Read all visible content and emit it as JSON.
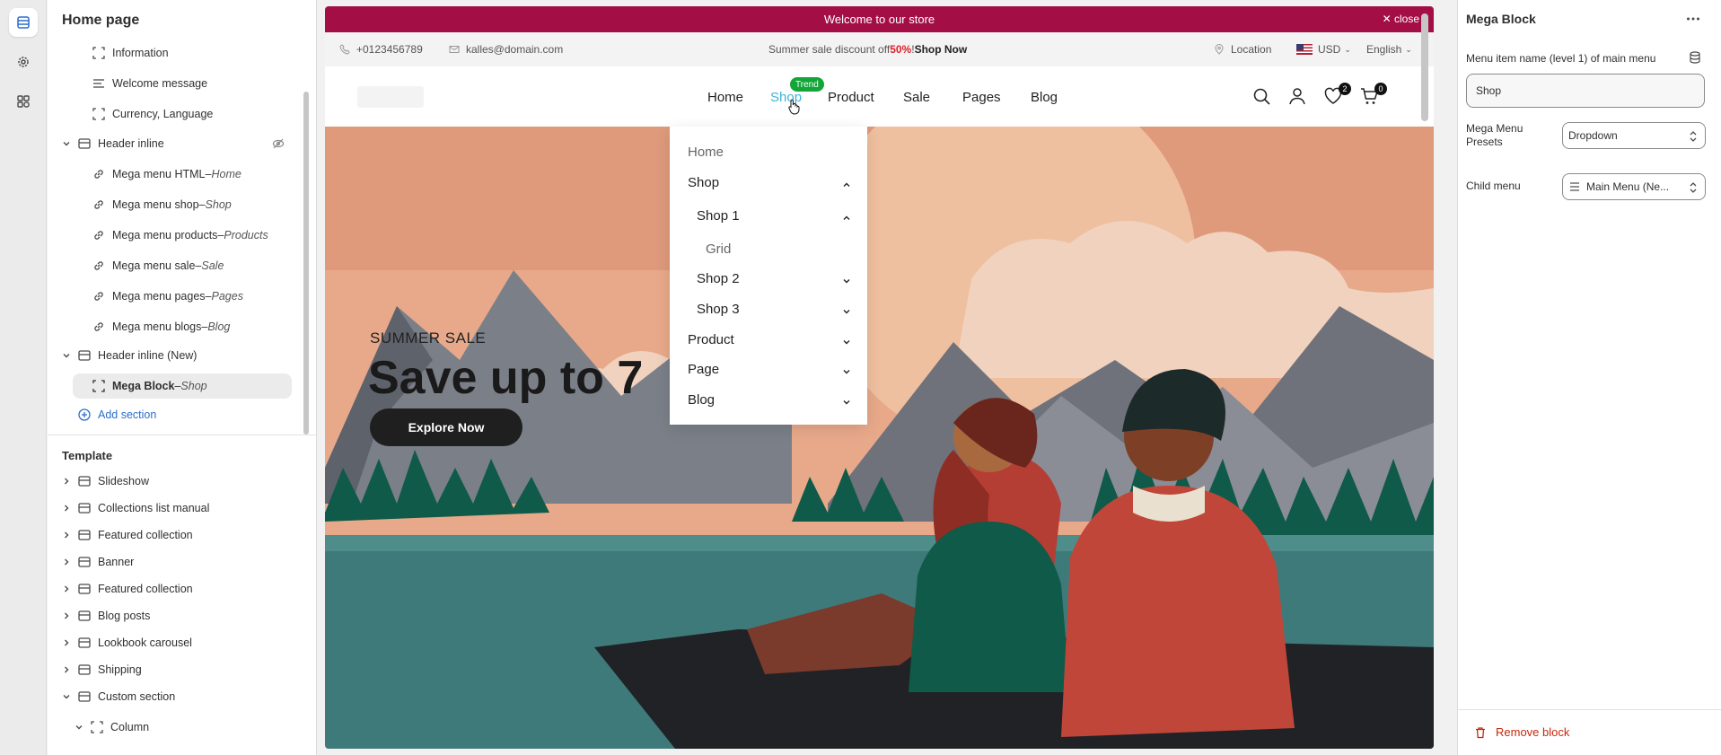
{
  "left_panel": {
    "title": "Home page",
    "header_items": [
      {
        "label": "Information",
        "icon": "block-icon"
      },
      {
        "label": "Welcome message",
        "icon": "text-icon"
      },
      {
        "label": "Currency, Language",
        "icon": "block-icon"
      }
    ],
    "header_inline": {
      "label": "Header inline",
      "children": [
        {
          "label": "Mega menu HTML",
          "target": "Home"
        },
        {
          "label": "Mega menu shop",
          "target": "Shop"
        },
        {
          "label": "Mega menu products",
          "target": "Products"
        },
        {
          "label": "Mega menu sale",
          "target": "Sale"
        },
        {
          "label": "Mega menu pages",
          "target": "Pages"
        },
        {
          "label": "Mega menu blogs",
          "target": "Blog"
        }
      ]
    },
    "header_inline_new": {
      "label": "Header inline (New)",
      "selected_child": {
        "label": "Mega Block",
        "target": "Shop"
      }
    },
    "separator": " – ",
    "add_section": "Add section",
    "template_title": "Template",
    "template_sections": [
      "Slideshow",
      "Collections list manual",
      "Featured collection",
      "Banner",
      "Featured collection",
      "Blog posts",
      "Lookbook carousel",
      "Shipping",
      "Custom section"
    ],
    "column_label": "Column"
  },
  "preview": {
    "announcement": "Welcome to our store",
    "announcement_close": "close",
    "phone": "+0123456789",
    "email": "kalles@domain.com",
    "promo_prefix": "Summer sale discount off ",
    "promo_percent": "50%",
    "promo_bang": "! ",
    "promo_link": "Shop Now",
    "location": "Location",
    "currency": "USD",
    "language": "English",
    "nav": [
      "Home",
      "Shop",
      "Product",
      "Sale",
      "Pages",
      "Blog"
    ],
    "trend_badge": "Trend",
    "wishlist_count": "2",
    "cart_count": "0",
    "hero_subtitle": "SUMMER SALE",
    "hero_title": "Save up to 7",
    "hero_button": "Explore Now",
    "dropdown": [
      {
        "label": "Home",
        "level": 0,
        "chevron": "none",
        "muted": true
      },
      {
        "label": "Shop",
        "level": 0,
        "chevron": "up"
      },
      {
        "label": "Shop 1",
        "level": 1,
        "chevron": "up"
      },
      {
        "label": "Grid",
        "level": 2,
        "chevron": "none",
        "muted": true
      },
      {
        "label": "Shop 2",
        "level": 1,
        "chevron": "down"
      },
      {
        "label": "Shop 3",
        "level": 1,
        "chevron": "down"
      },
      {
        "label": "Product",
        "level": 0,
        "chevron": "down"
      },
      {
        "label": "Page",
        "level": 0,
        "chevron": "down"
      },
      {
        "label": "Blog",
        "level": 0,
        "chevron": "down"
      }
    ]
  },
  "right_panel": {
    "title": "Mega Block",
    "menu_item_label": "Menu item name (level 1) of main menu",
    "menu_item_value": "Shop",
    "presets_label_line1": "Mega Menu",
    "presets_label_line2": "Presets",
    "presets_value": "Dropdown",
    "child_menu_label": "Child menu",
    "child_menu_value": "Main Menu (Ne...",
    "remove_label": "Remove block"
  },
  "colors": {
    "announcement_bg": "#a30f45",
    "accent_link": "#2c6ecb",
    "nav_active": "#3fb4d8",
    "trend_badge": "#13a538",
    "remove": "#c5280c"
  }
}
